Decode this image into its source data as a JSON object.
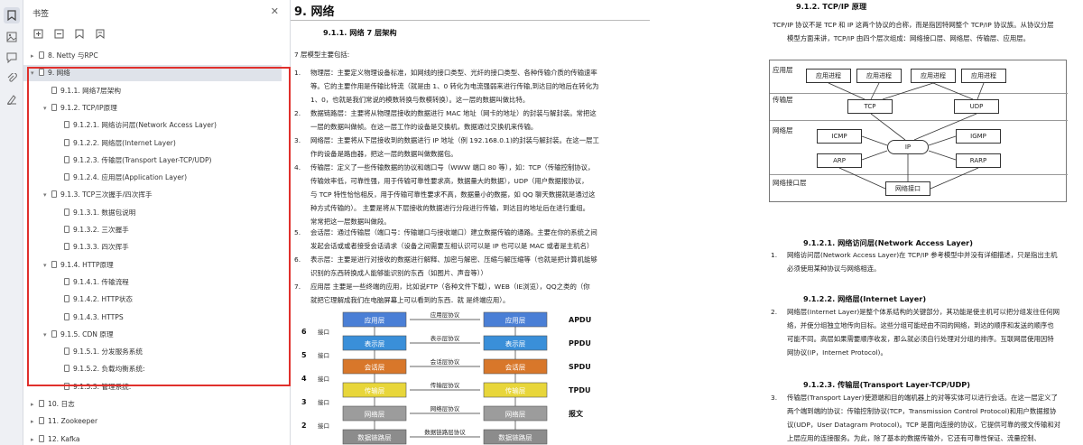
{
  "sidebar_title": "书签",
  "bookmarks": [
    {
      "label": "8. Netty 与RPC",
      "level": 0,
      "twisty": "▸"
    },
    {
      "label": "9. 网络",
      "level": 0,
      "twisty": "▾"
    },
    {
      "label": "9.1.1. 网络7层架构",
      "level": 1,
      "twisty": ""
    },
    {
      "label": "9.1.2. TCP/IP原理",
      "level": 1,
      "twisty": "▾"
    },
    {
      "label": "9.1.2.1. 网络访问层(Network Access Layer)",
      "level": 2,
      "twisty": ""
    },
    {
      "label": "9.1.2.2. 网络层(Internet Layer)",
      "level": 2,
      "twisty": ""
    },
    {
      "label": "9.1.2.3. 传输层(Transport Layer-TCP/UDP)",
      "level": 2,
      "twisty": ""
    },
    {
      "label": "9.1.2.4. 应用层(Application Layer)",
      "level": 2,
      "twisty": ""
    },
    {
      "label": "9.1.3. TCP三次握手/四次挥手",
      "level": 1,
      "twisty": "▾"
    },
    {
      "label": "9.1.3.1. 数据包说明",
      "level": 2,
      "twisty": ""
    },
    {
      "label": "9.1.3.2. 三次握手",
      "level": 2,
      "twisty": ""
    },
    {
      "label": "9.1.3.3. 四次挥手",
      "level": 2,
      "twisty": ""
    },
    {
      "label": "9.1.4. HTTP原理",
      "level": 1,
      "twisty": "▾"
    },
    {
      "label": "9.1.4.1. 传输流程",
      "level": 2,
      "twisty": ""
    },
    {
      "label": "9.1.4.2. HTTP状态",
      "level": 2,
      "twisty": ""
    },
    {
      "label": "9.1.4.3. HTTPS",
      "level": 2,
      "twisty": ""
    },
    {
      "label": "9.1.5. CDN 原理",
      "level": 1,
      "twisty": "▾"
    },
    {
      "label": "9.1.5.1. 分发服务系统",
      "level": 2,
      "twisty": ""
    },
    {
      "label": "9.1.5.2. 负载均衡系统:",
      "level": 2,
      "twisty": ""
    },
    {
      "label": "9.1.5.3. 管理系统:",
      "level": 2,
      "twisty": ""
    },
    {
      "label": "10. 日志",
      "level": 0,
      "twisty": "▸"
    },
    {
      "label": "11. Zookeeper",
      "level": 0,
      "twisty": "▸"
    },
    {
      "label": "12. Kafka",
      "level": 0,
      "twisty": "▸"
    },
    {
      "label": "13. RabbitMQ",
      "level": 0,
      "twisty": "▸"
    }
  ],
  "left_page": {
    "title": "9. 网络",
    "section": "9.1.1.   网络 7 层架构",
    "intro": "7 层模型主要包括:",
    "items": [
      {
        "n": "1.",
        "lines": [
          "物理层：主要定义物理设备标准，如网线的接口类型、光纤的接口类型、各种传输介质的传输速率",
          "等。它的主要作用是传输比特流（就是由 1、0 转化为电流强弱来进行传输,到达目的地后在转化为",
          "1、0，也就是我们常说的模数转换与数模转换）。这一层的数据叫做比特。"
        ]
      },
      {
        "n": "2.",
        "lines": [
          "数据链路层：主要将从物理层接收的数据进行 MAC 地址（网卡的地址）的封装与解封装。常把这",
          "一层的数据叫做帧。在这一层工作的设备是交换机，数据通过交换机来传输。"
        ]
      },
      {
        "n": "3.",
        "lines": [
          "网络层：主要将从下层接收到的数据进行 IP 地址（例 192.168.0.1)的封装与解封装。在这一层工",
          "作的设备是路由器，把这一层的数据叫做数据包。"
        ]
      },
      {
        "n": "4.",
        "lines": [
          "传输层：定义了一些传输数据的协议和端口号（WWW 端口 80 等），如：TCP（传输控制协议，",
          "传输效率低，可靠性强，用于传输可靠性要求高，数据量大的数据），UDP（用户数据报协议，",
          "与 TCP 特性恰恰相反，用于传输可靠性要求不高，数据量小的数据，如 QQ 聊天数据就是通过这",
          "种方式传输的）。 主要是将从下层接收的数据进行分段进行传输，到达目的地址后在进行重组。",
          "常常把这一层数据叫做段。"
        ]
      },
      {
        "n": "5.",
        "lines": [
          "会话层：通过传输层（端口号：传输端口与接收端口）建立数据传输的通路。主要在你的系统之间",
          "发起会话或或者接受会话请求（设备之间需要互相认识可以是 IP 也可以是 MAC 或者是主机名）"
        ]
      },
      {
        "n": "6.",
        "lines": [
          "表示层：主要是进行对接收的数据进行解释、加密与解密、压缩与解压缩等（也就是把计算机能够",
          "识别的东西转换成人能够能识别的东西（如图片、声音等））"
        ]
      },
      {
        "n": "7.",
        "lines": [
          "应用层 主要是一些终端的应用，比如说FTP（各种文件下载），WEB（IE浏览），QQ之类的（你",
          "就把它理解成我们在电脑屏幕上可以看到的东西．就 是终端应用）。"
        ]
      }
    ],
    "osi": {
      "layers": [
        "应用层",
        "表示层",
        "会话层",
        "传输层",
        "网络层",
        "数据链路层"
      ],
      "numbers": [
        "6",
        "5",
        "4",
        "3",
        "2"
      ],
      "protocols": [
        "应用层协议",
        "表示层协议",
        "会话层协议",
        "传输层协议",
        "网络层协议",
        "数据链路层协议"
      ],
      "pdus": [
        "APDU",
        "PPDU",
        "SPDU",
        "TPDU",
        "报文"
      ],
      "port": "接口",
      "colors": [
        "#4a7fd6",
        "#3a8fd9",
        "#d8772a",
        "#e8d63a",
        "#9c9c9c",
        "#8c8c8c"
      ]
    }
  },
  "right_page": {
    "section": "9.1.2.   TCP/IP 原理",
    "p1": [
      "TCP/IP 协议不是 TCP 和 IP 这两个协议的合称，而是指因特网整个 TCP/IP 协议族。从协议分层",
      "模型方面来讲，TCP/IP 由四个层次组成：网络接口层、网络层、传输层、应用层。"
    ],
    "figure": {
      "layers": [
        "应用层",
        "传输层",
        "网络层",
        "网络接口层"
      ],
      "app_boxes": [
        "应用进程",
        "应用进程",
        "应用进程",
        "应用进程"
      ],
      "tcp": "TCP",
      "udp": "UDP",
      "icmp": "ICMP",
      "igmp": "IGMP",
      "ip": "IP",
      "arp": "ARP",
      "rarp": "RARP",
      "nic": "网络接口"
    },
    "s1": "9.1.2.1.      网络访问层(Network Access Layer)",
    "s1_item": {
      "n": "1.",
      "lines": [
        "网络访问层(Network Access Layer)在 TCP/IP 参考模型中并没有详细描述，只是指出主机",
        "必须使用某种协议与网络相连。"
      ]
    },
    "s2": "9.1.2.2.      网络层(Internet Layer)",
    "s2_item": {
      "n": "2.",
      "lines": [
        "网络层(Internet Layer)是整个体系结构的关键部分，其功能是使主机可以把分组发往任何网",
        "络，并使分组独立地传向目标。这些分组可能经由不同的网络，到达的顺序和发送的顺序也",
        "可能不同。高层如果需要顺序收发，那么就必须自行处理对分组的排序。互联网层使用因特",
        "网协议(IP，Internet Protocol)。"
      ]
    },
    "s3": "9.1.2.3.      传输层(Transport Layer-TCP/UDP)",
    "s3_item": {
      "n": "3.",
      "lines": [
        "传输层(Transport Layer)使源端和目的端机器上的对等实体可以进行会话。在这一层定义了",
        "两个端到端的协议：传输控制协议(TCP，Transmission Control Protocol)和用户数据报协",
        "议(UDP，User Datagram Protocol)。TCP 是面向连接的协议，它提供可靠的报文传输和对",
        "上层应用的连接服务。为此，除了基本的数据传输外，它还有可靠性保证、流量控制、"
      ]
    }
  }
}
